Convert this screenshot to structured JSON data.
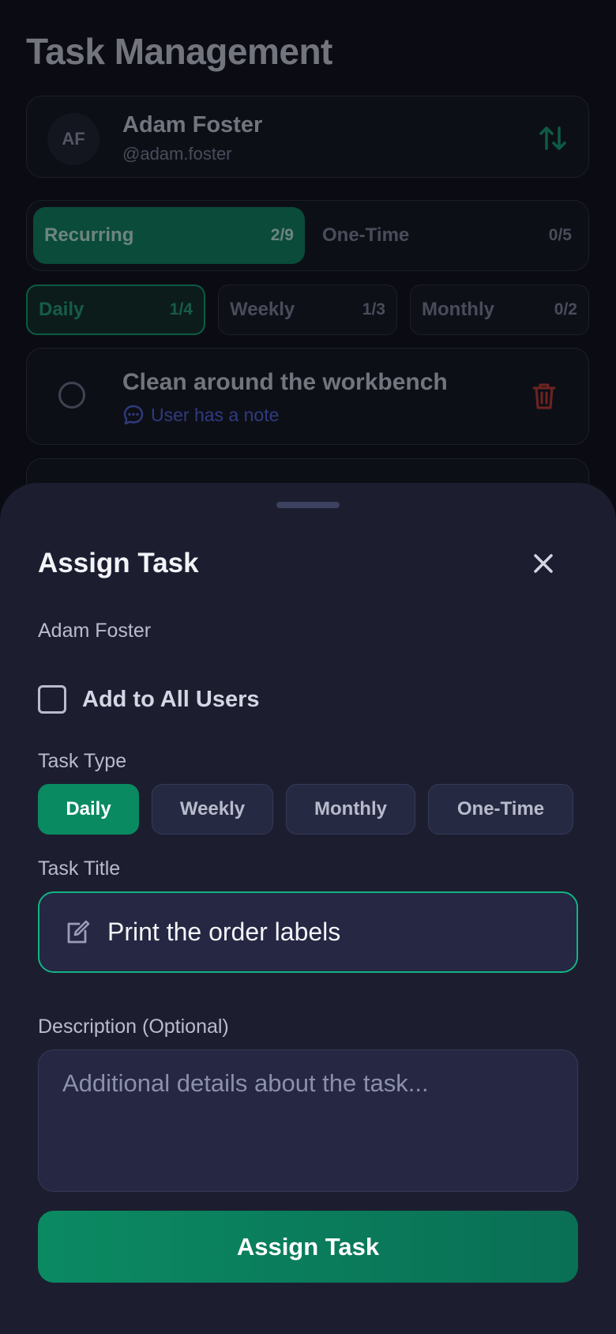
{
  "app": {
    "title": "Task Management"
  },
  "user": {
    "initials": "AF",
    "name": "Adam Foster",
    "handle": "@adam.foster"
  },
  "segments": [
    {
      "label": "Recurring",
      "count": "2/9"
    },
    {
      "label": "One-Time",
      "count": "0/5"
    }
  ],
  "filters": [
    {
      "label": "Daily",
      "count": "1/4"
    },
    {
      "label": "Weekly",
      "count": "1/3"
    },
    {
      "label": "Monthly",
      "count": "0/2"
    }
  ],
  "task": {
    "title": "Clean around the workbench",
    "note": "User has a note"
  },
  "sheet": {
    "title": "Assign Task",
    "assignee": "Adam Foster",
    "add_all_label": "Add to All Users",
    "type_label": "Task Type",
    "types": [
      "Daily",
      "Weekly",
      "Monthly",
      "One-Time"
    ],
    "title_label": "Task Title",
    "title_value": "Print the order labels",
    "desc_label": "Description (Optional)",
    "desc_placeholder": "Additional details about the task...",
    "submit_label": "Assign Task"
  },
  "colors": {
    "accent": "#0a8a61",
    "note": "#4e62d6",
    "danger": "#c0392b"
  }
}
